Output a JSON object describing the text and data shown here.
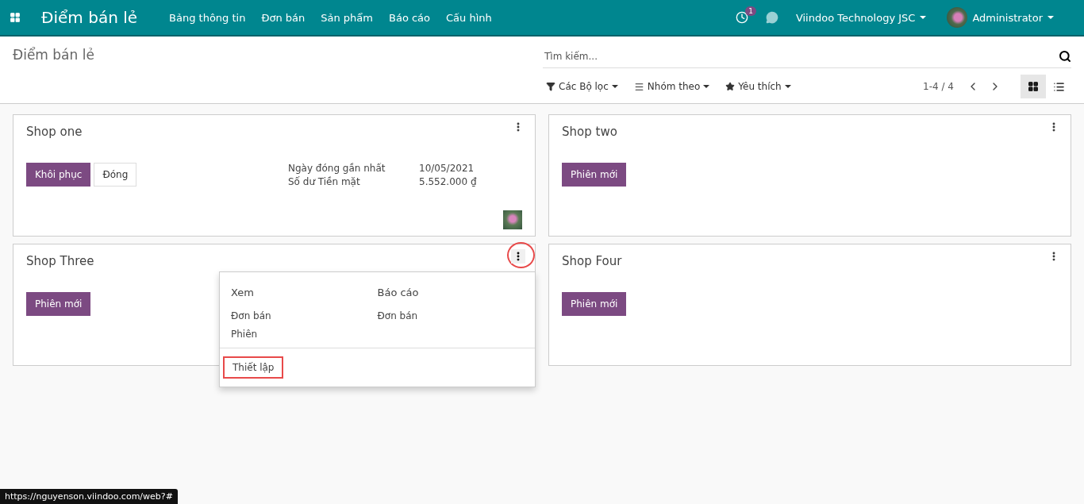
{
  "navbar": {
    "app_title": "Điểm bán lẻ",
    "menu": [
      "Bảng thông tin",
      "Đơn bán",
      "Sản phẩm",
      "Báo cáo",
      "Cấu hình"
    ],
    "activity_count": "1",
    "company": "Viindoo Technology JSC",
    "user": "Administrator"
  },
  "control_panel": {
    "breadcrumb": "Điểm bán lẻ",
    "search": {
      "placeholder": "Tìm kiếm..."
    },
    "filters": [
      {
        "kind": "filter",
        "label": "Các Bộ lọc"
      },
      {
        "kind": "group",
        "label": "Nhóm theo"
      },
      {
        "kind": "favorite",
        "label": "Yêu thích"
      }
    ],
    "pager": "1-4 / 4",
    "views": [
      {
        "kind": "kanban",
        "selected": true
      },
      {
        "kind": "list",
        "selected": false
      }
    ]
  },
  "cards": [
    {
      "title": "Shop one",
      "buttons": [
        {
          "label": "Khôi phục",
          "kind": "primary"
        },
        {
          "label": "Đóng",
          "kind": "secondary"
        }
      ],
      "stats": [
        {
          "label": "Ngày đóng gần nhất",
          "value": "10/05/2021"
        },
        {
          "label": "Số dư Tiền mặt",
          "value": "5.552.000 ₫"
        }
      ],
      "avatar": true,
      "menu_open": false,
      "highlighted": false
    },
    {
      "title": "Shop two",
      "buttons": [
        {
          "label": "Phiên mới",
          "kind": "primary"
        }
      ],
      "avatar": false,
      "menu_open": false,
      "highlighted": false
    },
    {
      "title": "Shop Three",
      "buttons": [
        {
          "label": "Phiên mới",
          "kind": "primary"
        }
      ],
      "avatar": false,
      "menu_open": true,
      "highlighted": true
    },
    {
      "title": "Shop Four",
      "buttons": [
        {
          "label": "Phiên mới",
          "kind": "primary"
        }
      ],
      "avatar": false,
      "menu_open": false,
      "highlighted": false
    }
  ],
  "dropdown": {
    "columns": [
      {
        "heading": "Xem",
        "items": [
          "Đơn bán",
          "Phiên"
        ]
      },
      {
        "heading": "Báo cáo",
        "items": [
          "Đơn bán"
        ]
      }
    ],
    "footer": [
      {
        "label": "Thiết lập",
        "highlighted": true
      }
    ]
  },
  "status_url": "https://nguyenson.viindoo.com/web?#"
}
